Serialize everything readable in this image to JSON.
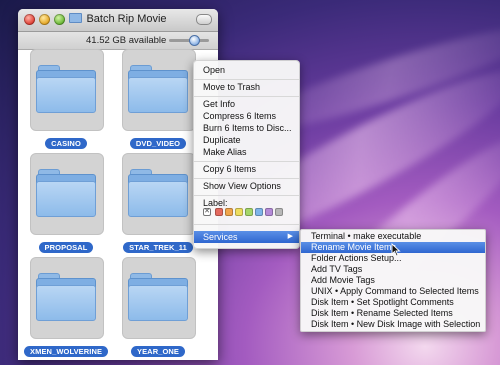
{
  "window": {
    "title": "Batch Rip Movie",
    "status": "41.52 GB available"
  },
  "folders": [
    {
      "label": "CASINO"
    },
    {
      "label": "DVD_VIDEO"
    },
    {
      "label": "PROPOSAL"
    },
    {
      "label": "STAR_TREK_11"
    },
    {
      "label": "XMEN_WOLVERINE"
    },
    {
      "label": "YEAR_ONE"
    }
  ],
  "context_menu": {
    "items": [
      "Open",
      "Move to Trash",
      "Get Info",
      "Compress 6 Items",
      "Burn 6 Items to Disc...",
      "Duplicate",
      "Make Alias",
      "Copy 6 Items",
      "Show View Options",
      "Label:",
      "Services"
    ],
    "label_colors": [
      "#e46a5e",
      "#f0a54b",
      "#eedd5e",
      "#a5d66a",
      "#7fb4ea",
      "#b58bd8",
      "#b8b8b8"
    ],
    "highlight": "#2f66d0"
  },
  "services_menu": {
    "items": [
      "Terminal • make executable",
      "Rename Movie Items",
      "Folder Actions Setup...",
      "Add TV Tags",
      "Add Movie Tags",
      "UNIX • Apply Command to Selected Items",
      "Disk Item • Set Spotlight Comments",
      "Disk Item • Rename Selected Items",
      "Disk Item • New Disk Image with Selection"
    ],
    "selected": "Rename Movie Items"
  }
}
